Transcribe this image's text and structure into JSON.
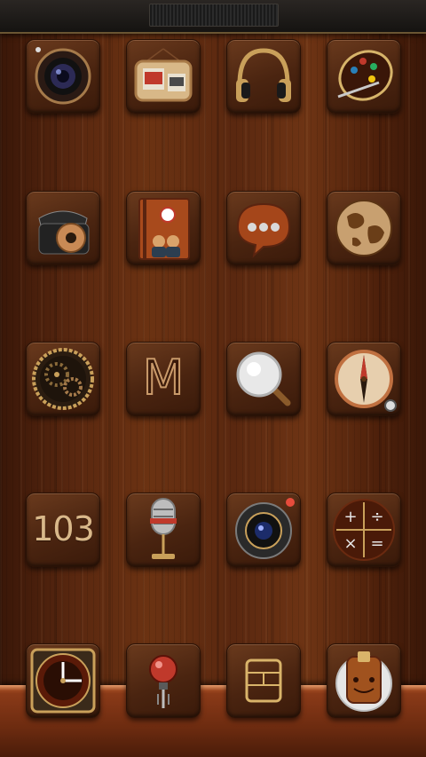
{
  "status_bar": {
    "vent": "notch"
  },
  "icons": [
    {
      "name": "camera-icon",
      "row": 0,
      "col": 0
    },
    {
      "name": "gallery-icon",
      "row": 0,
      "col": 1
    },
    {
      "name": "music-headphones-icon",
      "row": 0,
      "col": 2
    },
    {
      "name": "theme-palette-icon",
      "row": 0,
      "col": 3
    },
    {
      "name": "phone-icon",
      "row": 1,
      "col": 0
    },
    {
      "name": "contacts-icon",
      "row": 1,
      "col": 1
    },
    {
      "name": "messages-icon",
      "row": 1,
      "col": 2
    },
    {
      "name": "browser-globe-icon",
      "row": 1,
      "col": 3
    },
    {
      "name": "settings-gear-icon",
      "row": 2,
      "col": 0
    },
    {
      "name": "mail-icon",
      "row": 2,
      "col": 1,
      "text": "M"
    },
    {
      "name": "search-icon",
      "row": 2,
      "col": 2
    },
    {
      "name": "compass-icon",
      "row": 2,
      "col": 3
    },
    {
      "name": "fm-radio-icon",
      "row": 3,
      "col": 0,
      "text": "103"
    },
    {
      "name": "voice-recorder-icon",
      "row": 3,
      "col": 1
    },
    {
      "name": "video-camera-icon",
      "row": 3,
      "col": 2
    },
    {
      "name": "calculator-icon",
      "row": 3,
      "col": 3
    },
    {
      "name": "clock-icon",
      "row": 4,
      "col": 0
    },
    {
      "name": "flashlight-icon",
      "row": 4,
      "col": 1
    },
    {
      "name": "sim-toolkit-icon",
      "row": 4,
      "col": 2
    },
    {
      "name": "store-face-icon",
      "row": 4,
      "col": 3
    }
  ],
  "labels": {
    "mail": "M",
    "radio": "103"
  },
  "colors": {
    "wood": "#5a2810",
    "tile": "#4a2410",
    "brass": "#c9a05a",
    "accent_red": "#c0392b"
  }
}
